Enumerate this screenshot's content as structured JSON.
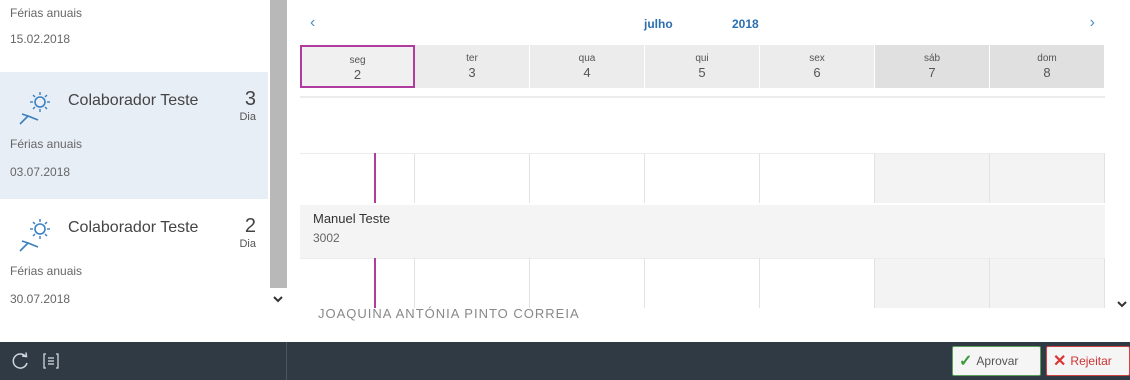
{
  "list": {
    "top": {
      "type": "Férias anuais",
      "date": "15.02.2018"
    },
    "items": [
      {
        "name": "Colaborador Teste",
        "count": "3",
        "unit": "Dia",
        "type": "Férias anuais",
        "date": "03.07.2018",
        "selected": true
      },
      {
        "name": "Colaborador Teste",
        "count": "2",
        "unit": "Dia",
        "type": "Férias anuais",
        "date": "30.07.2018",
        "selected": false
      }
    ]
  },
  "calendar": {
    "prev": "‹",
    "next": "›",
    "month": "julho",
    "year": "2018",
    "days": [
      {
        "name": "seg",
        "num": "2"
      },
      {
        "name": "ter",
        "num": "3"
      },
      {
        "name": "qua",
        "num": "4"
      },
      {
        "name": "qui",
        "num": "5"
      },
      {
        "name": "sex",
        "num": "6"
      },
      {
        "name": "sáb",
        "num": "7"
      },
      {
        "name": "dom",
        "num": "8"
      }
    ],
    "employee": {
      "name": "Manuel Teste",
      "id": "3002"
    },
    "cut_text": "JOAQUINA ANTÓNIA PINTO CORREIA",
    "accent": "#b03ca0"
  },
  "footer": {
    "approve": "Aprovar",
    "reject": "Rejeitar",
    "approve_glyph": "✓",
    "reject_glyph": "✕",
    "bg": "#2f3a44"
  }
}
